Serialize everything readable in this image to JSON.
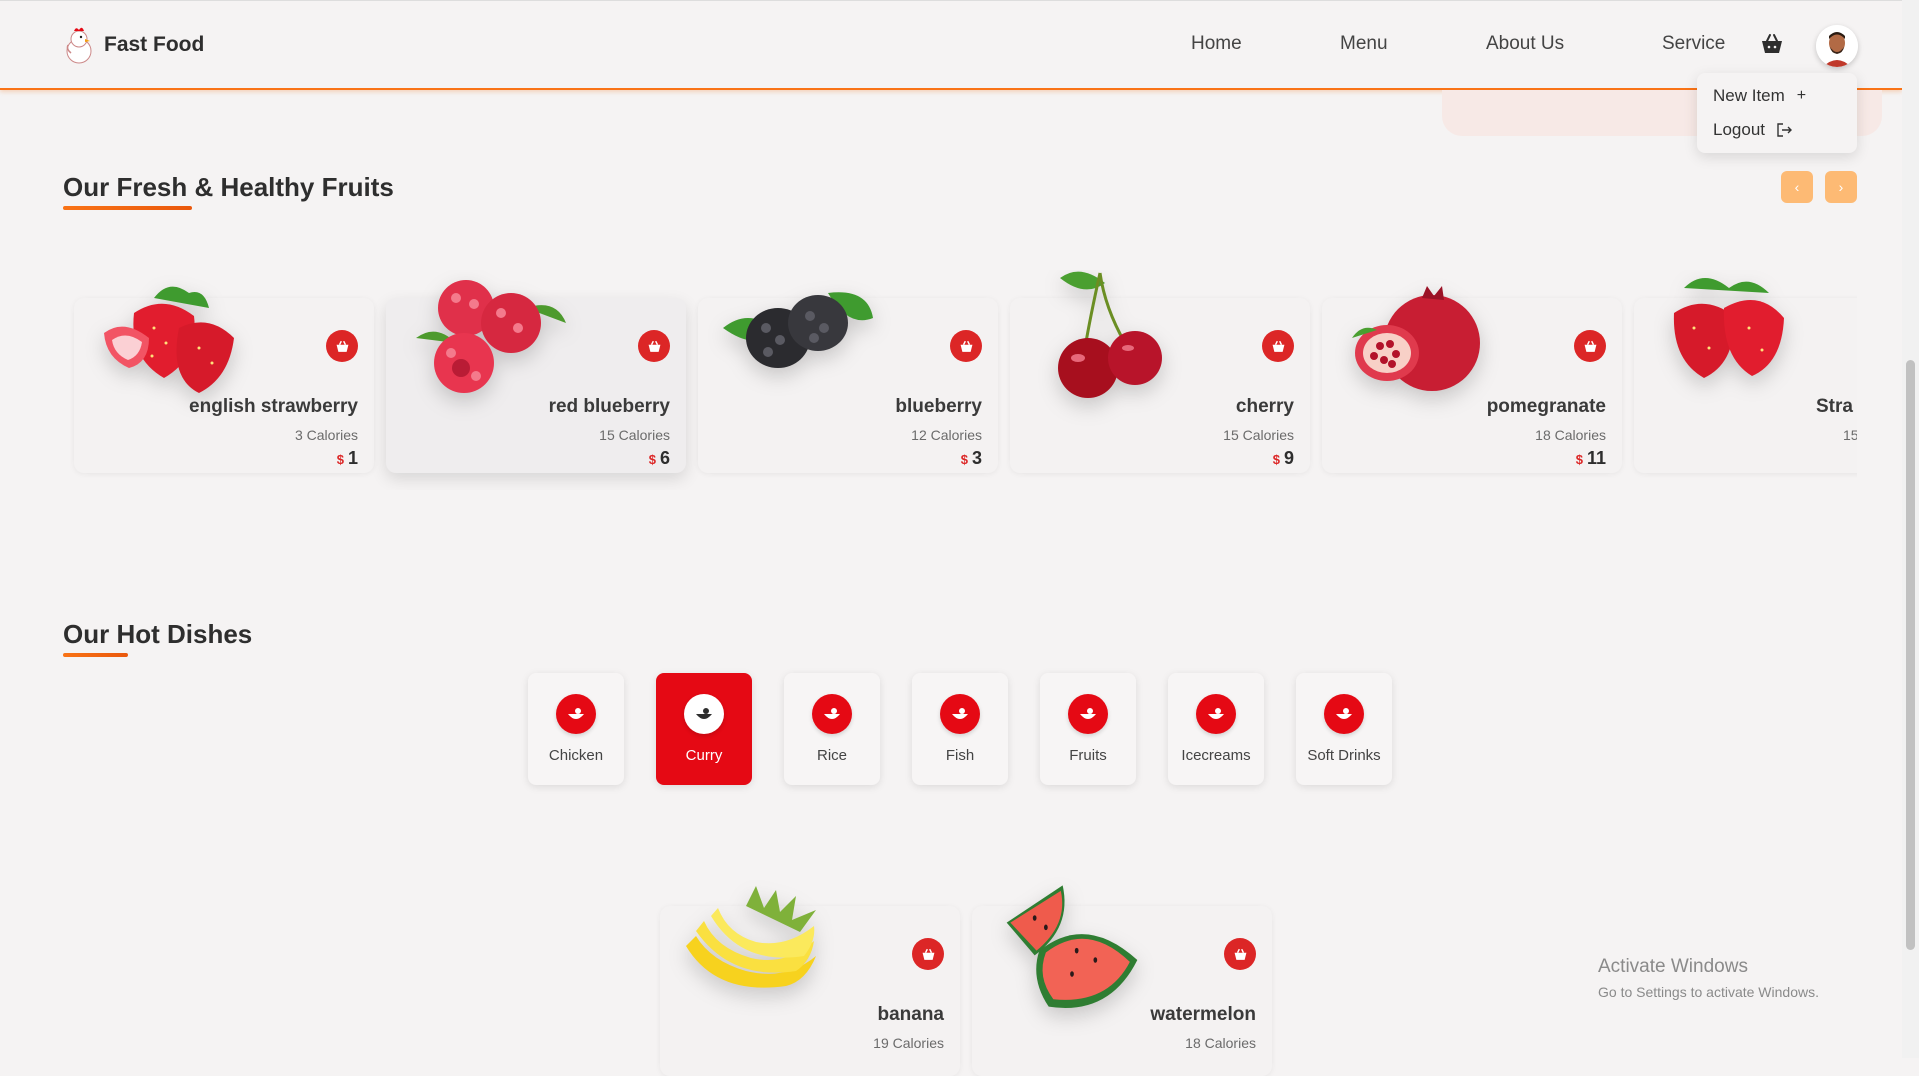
{
  "header": {
    "brand": "Fast Food",
    "nav": [
      "Home",
      "Menu",
      "About Us",
      "Service"
    ]
  },
  "dropdown": {
    "items": [
      {
        "label": "New Item",
        "icon": "plus-icon"
      },
      {
        "label": "Logout",
        "icon": "logout-icon"
      }
    ]
  },
  "fruits_section": {
    "title": "Our Fresh & Healthy Fruits",
    "prev": "‹",
    "next": "›",
    "cards": [
      {
        "name": "english strawberry",
        "calories": "3 Calories",
        "currency": "$",
        "price": "1",
        "image": "strawberry"
      },
      {
        "name": "red blueberry",
        "calories": "15 Calories",
        "currency": "$",
        "price": "6",
        "image": "raspberry"
      },
      {
        "name": "blueberry",
        "calories": "12 Calories",
        "currency": "$",
        "price": "3",
        "image": "blackberry"
      },
      {
        "name": "cherry",
        "calories": "15 Calories",
        "currency": "$",
        "price": "9",
        "image": "cherry"
      },
      {
        "name": "pomegranate",
        "calories": "18 Calories",
        "currency": "$",
        "price": "11",
        "image": "pomegranate"
      },
      {
        "name": "Stra",
        "calories": "15",
        "currency": "",
        "price": "",
        "image": "strawberry"
      }
    ]
  },
  "dishes_section": {
    "title": "Our Hot Dishes",
    "categories": [
      "Chicken",
      "Curry",
      "Rice",
      "Fish",
      "Fruits",
      "Icecreams",
      "Soft Drinks"
    ],
    "active_category": "Curry",
    "cards": [
      {
        "name": "banana",
        "calories": "19 Calories",
        "image": "banana"
      },
      {
        "name": "watermelon",
        "calories": "18 Calories",
        "image": "watermelon"
      }
    ]
  },
  "watermark": {
    "line1": "Activate Windows",
    "line2": "Go to Settings to activate Windows."
  },
  "colors": {
    "accent": "#f97316",
    "brand_red": "#e50914",
    "background": "#f5f3f3"
  }
}
